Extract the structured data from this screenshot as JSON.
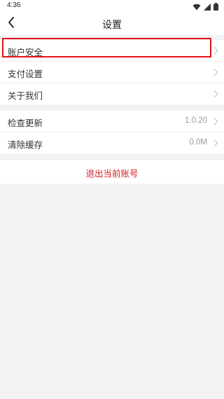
{
  "status_bar": {
    "time": "4:36",
    "icons": [
      "wifi-icon",
      "signal-icon",
      "battery-icon"
    ]
  },
  "header": {
    "title": "设置",
    "back_icon": "back-arrow-icon"
  },
  "groups": [
    {
      "items": [
        {
          "label": "账户安全",
          "highlighted": true
        },
        {
          "label": "支付设置"
        },
        {
          "label": "关于我们"
        }
      ]
    },
    {
      "items": [
        {
          "label": "检查更新",
          "value": "1.0.20"
        },
        {
          "label": "清除缓存",
          "value": "0.0M"
        }
      ]
    }
  ],
  "logout": {
    "label": "退出当前账号"
  },
  "colors": {
    "background": "#f3f3f5",
    "panel": "#ffffff",
    "highlight_border": "#e0141a",
    "logout_text": "#d0222a",
    "value_text": "#999999"
  }
}
